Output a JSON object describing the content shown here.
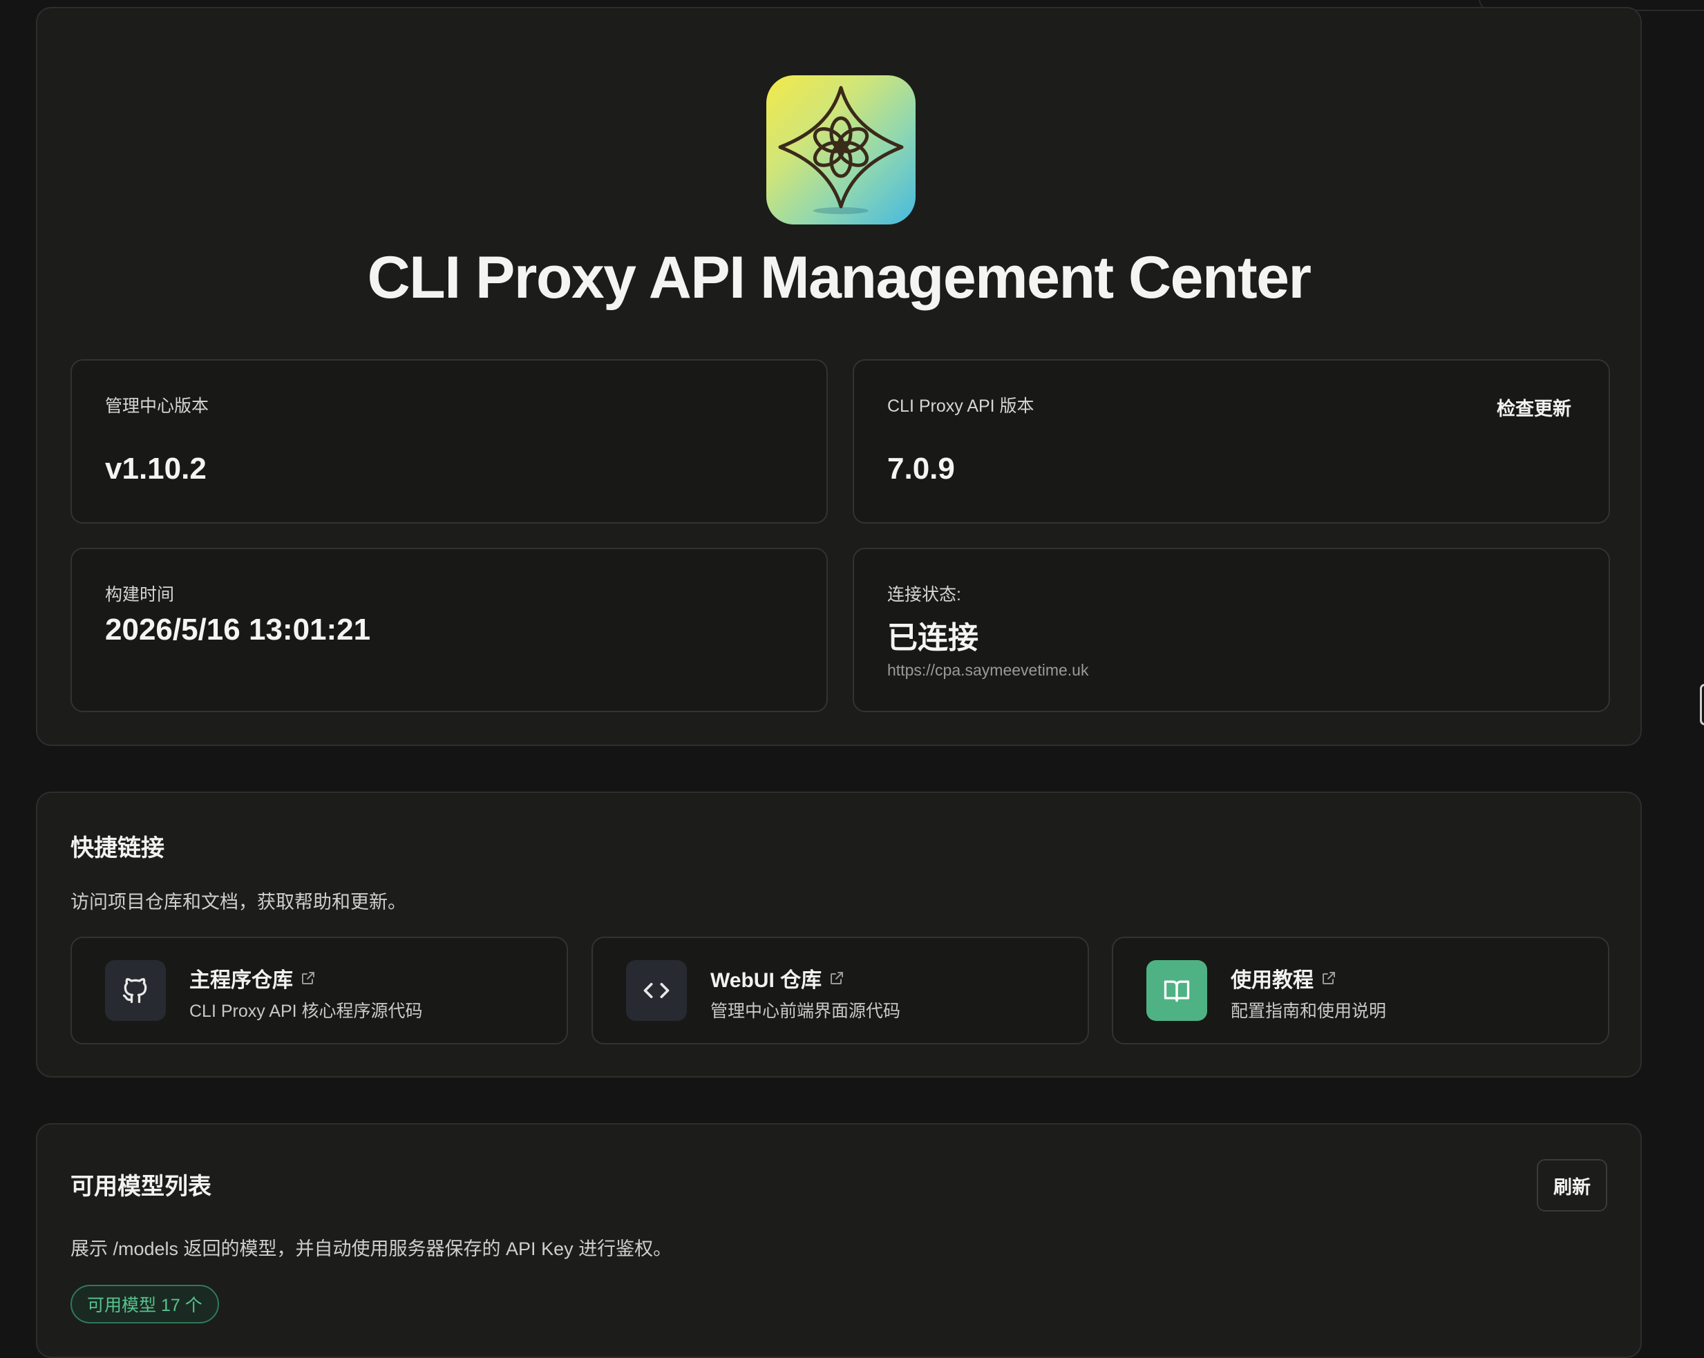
{
  "app": {
    "title": "CLI Proxy API Management Center",
    "logo": "openai-knot-logo"
  },
  "info": {
    "mgmt_version_label": "管理中心版本",
    "mgmt_version": "v1.10.2",
    "api_version_label": "CLI Proxy API 版本",
    "api_version": "7.0.9",
    "check_update": "检查更新",
    "build_time_label": "构建时间",
    "build_time": "2026/5/16 13:01:21",
    "connection_label": "连接状态:",
    "connection_status": "已连接",
    "connection_url": "https://cpa.saymeevetime.uk"
  },
  "quick_links": {
    "title": "快捷链接",
    "description": "访问项目仓库和文档，获取帮助和更新。",
    "items": [
      {
        "title": "主程序仓库",
        "desc": "CLI Proxy API 核心程序源代码",
        "icon": "github-icon"
      },
      {
        "title": "WebUI 仓库",
        "desc": "管理中心前端界面源代码",
        "icon": "code-icon"
      },
      {
        "title": "使用教程",
        "desc": "配置指南和使用说明",
        "icon": "book-icon"
      }
    ]
  },
  "models": {
    "title": "可用模型列表",
    "refresh": "刷新",
    "description": "展示 /models 返回的模型，并自动使用服务器保存的 API Key 进行鉴权。",
    "badge": "可用模型 17 个"
  },
  "colors": {
    "background": "#141414",
    "card": "#1c1c1a",
    "accent_green": "#4fb284"
  }
}
